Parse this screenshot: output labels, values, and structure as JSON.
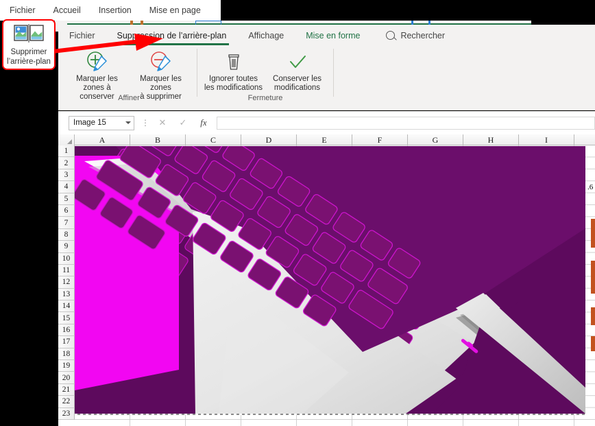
{
  "app": {
    "name": "Microsoft Excel",
    "accent_green": "#217346",
    "callout_red": "#ff0000",
    "overlay_magenta": "#ff00ff",
    "overlay_dark_magenta": "#5d0a5d"
  },
  "topbar": {
    "items": [
      {
        "label": "Fichier",
        "name": "menu-fichier"
      },
      {
        "label": "Accueil",
        "name": "menu-accueil"
      },
      {
        "label": "Insertion",
        "name": "menu-insertion"
      },
      {
        "label": "Mise en page",
        "name": "menu-mise-en-page"
      }
    ]
  },
  "callout": {
    "icon": "remove-background-icon",
    "line1": "Supprimer",
    "line2": "l’arrière-plan",
    "arrow": "red-arrow-right"
  },
  "ribbon": {
    "tabs": [
      {
        "label": "Fichier",
        "name": "tab-fichier",
        "state": "normal"
      },
      {
        "label": "Suppression de l’arrière-plan",
        "name": "tab-suppression-arriere-plan",
        "state": "active"
      },
      {
        "label": "Affichage",
        "name": "tab-affichage",
        "state": "normal"
      },
      {
        "label": "Mise en forme",
        "name": "tab-mise-en-forme",
        "state": "contextual"
      }
    ],
    "search": {
      "icon": "search-icon",
      "label": "Rechercher"
    },
    "groups": [
      {
        "name": "group-affiner",
        "title": "Affiner",
        "commands": [
          {
            "name": "cmd-marquer-zones-conserver",
            "icon": "mark-areas-to-keep-icon",
            "line1": "Marquer les",
            "line2": "zones à conserver"
          },
          {
            "name": "cmd-marquer-zones-supprimer",
            "icon": "mark-areas-to-remove-icon",
            "line1": "Marquer les zones",
            "line2": "à supprimer"
          }
        ]
      },
      {
        "name": "group-fermeture",
        "title": "Fermeture",
        "commands": [
          {
            "name": "cmd-ignorer-modifications",
            "icon": "trash-icon",
            "line1": "Ignorer toutes",
            "line2": "les modifications"
          },
          {
            "name": "cmd-conserver-modifications",
            "icon": "checkmark-icon",
            "line1": "Conserver les",
            "line2": "modifications"
          }
        ]
      }
    ]
  },
  "formula_bar": {
    "name_box_value": "Image 15",
    "name_box_caret": "chevron-down-icon",
    "expand_dots": "⋮",
    "cancel_icon": "✕",
    "confirm_icon": "✓",
    "function_icon": "fx",
    "input_value": "",
    "input_placeholder": ""
  },
  "grid": {
    "columns": [
      "A",
      "B",
      "C",
      "D",
      "E",
      "F",
      "G",
      "H",
      "I"
    ],
    "rows": [
      1,
      2,
      3,
      4,
      5,
      6,
      7,
      8,
      9,
      10,
      11,
      12,
      13,
      14,
      15,
      16,
      17,
      18,
      19,
      20,
      21,
      22,
      23
    ],
    "selected_object": "Image 15",
    "edge_cell_fragment": ".6"
  },
  "picture": {
    "name": "laptop-photo-with-background-removal-overlay",
    "subject": "MacBook keyboard and trackpad, top-down angled view",
    "removal_overlay_color": "#ff00ff",
    "background_color": "#5d0a5d"
  }
}
